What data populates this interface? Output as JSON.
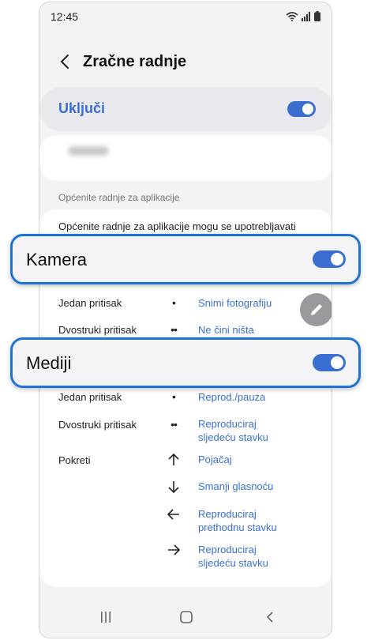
{
  "status": {
    "time": "12:45",
    "icons": [
      "wifi-icon",
      "signal-icon",
      "battery-icon"
    ]
  },
  "header": {
    "title": "Zračne radnje"
  },
  "master": {
    "label": "Uključi",
    "enabled": true
  },
  "section": {
    "label": "Općenite radnje za aplikacije"
  },
  "description": "Općenite radnje za aplikacije mogu se upotrebljavati",
  "camera": {
    "label": "Kamera",
    "enabled": true,
    "rows": [
      {
        "gesture": "Jedan pritisak",
        "symbol": "•",
        "action": "Snimi fotografiju"
      },
      {
        "gesture": "Dvostruki pritisak",
        "symbol": "••",
        "action": "Ne čini ništa"
      }
    ]
  },
  "media": {
    "label": "Mediji",
    "enabled": true,
    "rows": [
      {
        "gesture": "Jedan pritisak",
        "symbol": "•",
        "action": "Reprod./pauza"
      },
      {
        "gesture": "Dvostruki pritisak",
        "symbol": "••",
        "action_line1": "Reproduciraj",
        "action_line2": "sljedeću stavku"
      }
    ],
    "motions_label": "Pokreti",
    "motions": [
      {
        "icon": "arrow-up-icon",
        "action_line1": "Pojačaj"
      },
      {
        "icon": "arrow-down-icon",
        "action_line1": "Smanji glasnoću"
      },
      {
        "icon": "arrow-left-icon",
        "action_line1": "Reproduciraj",
        "action_line2": "prethodnu stavku"
      },
      {
        "icon": "arrow-right-icon",
        "action_line1": "Reproduciraj",
        "action_line2": "sljedeću stavku"
      }
    ]
  },
  "colors": {
    "accent": "#3a6fd0",
    "callout_border": "#1e73d8",
    "background": "#f3f3f5"
  },
  "nav": [
    "recents-icon",
    "home-icon",
    "back-icon"
  ]
}
